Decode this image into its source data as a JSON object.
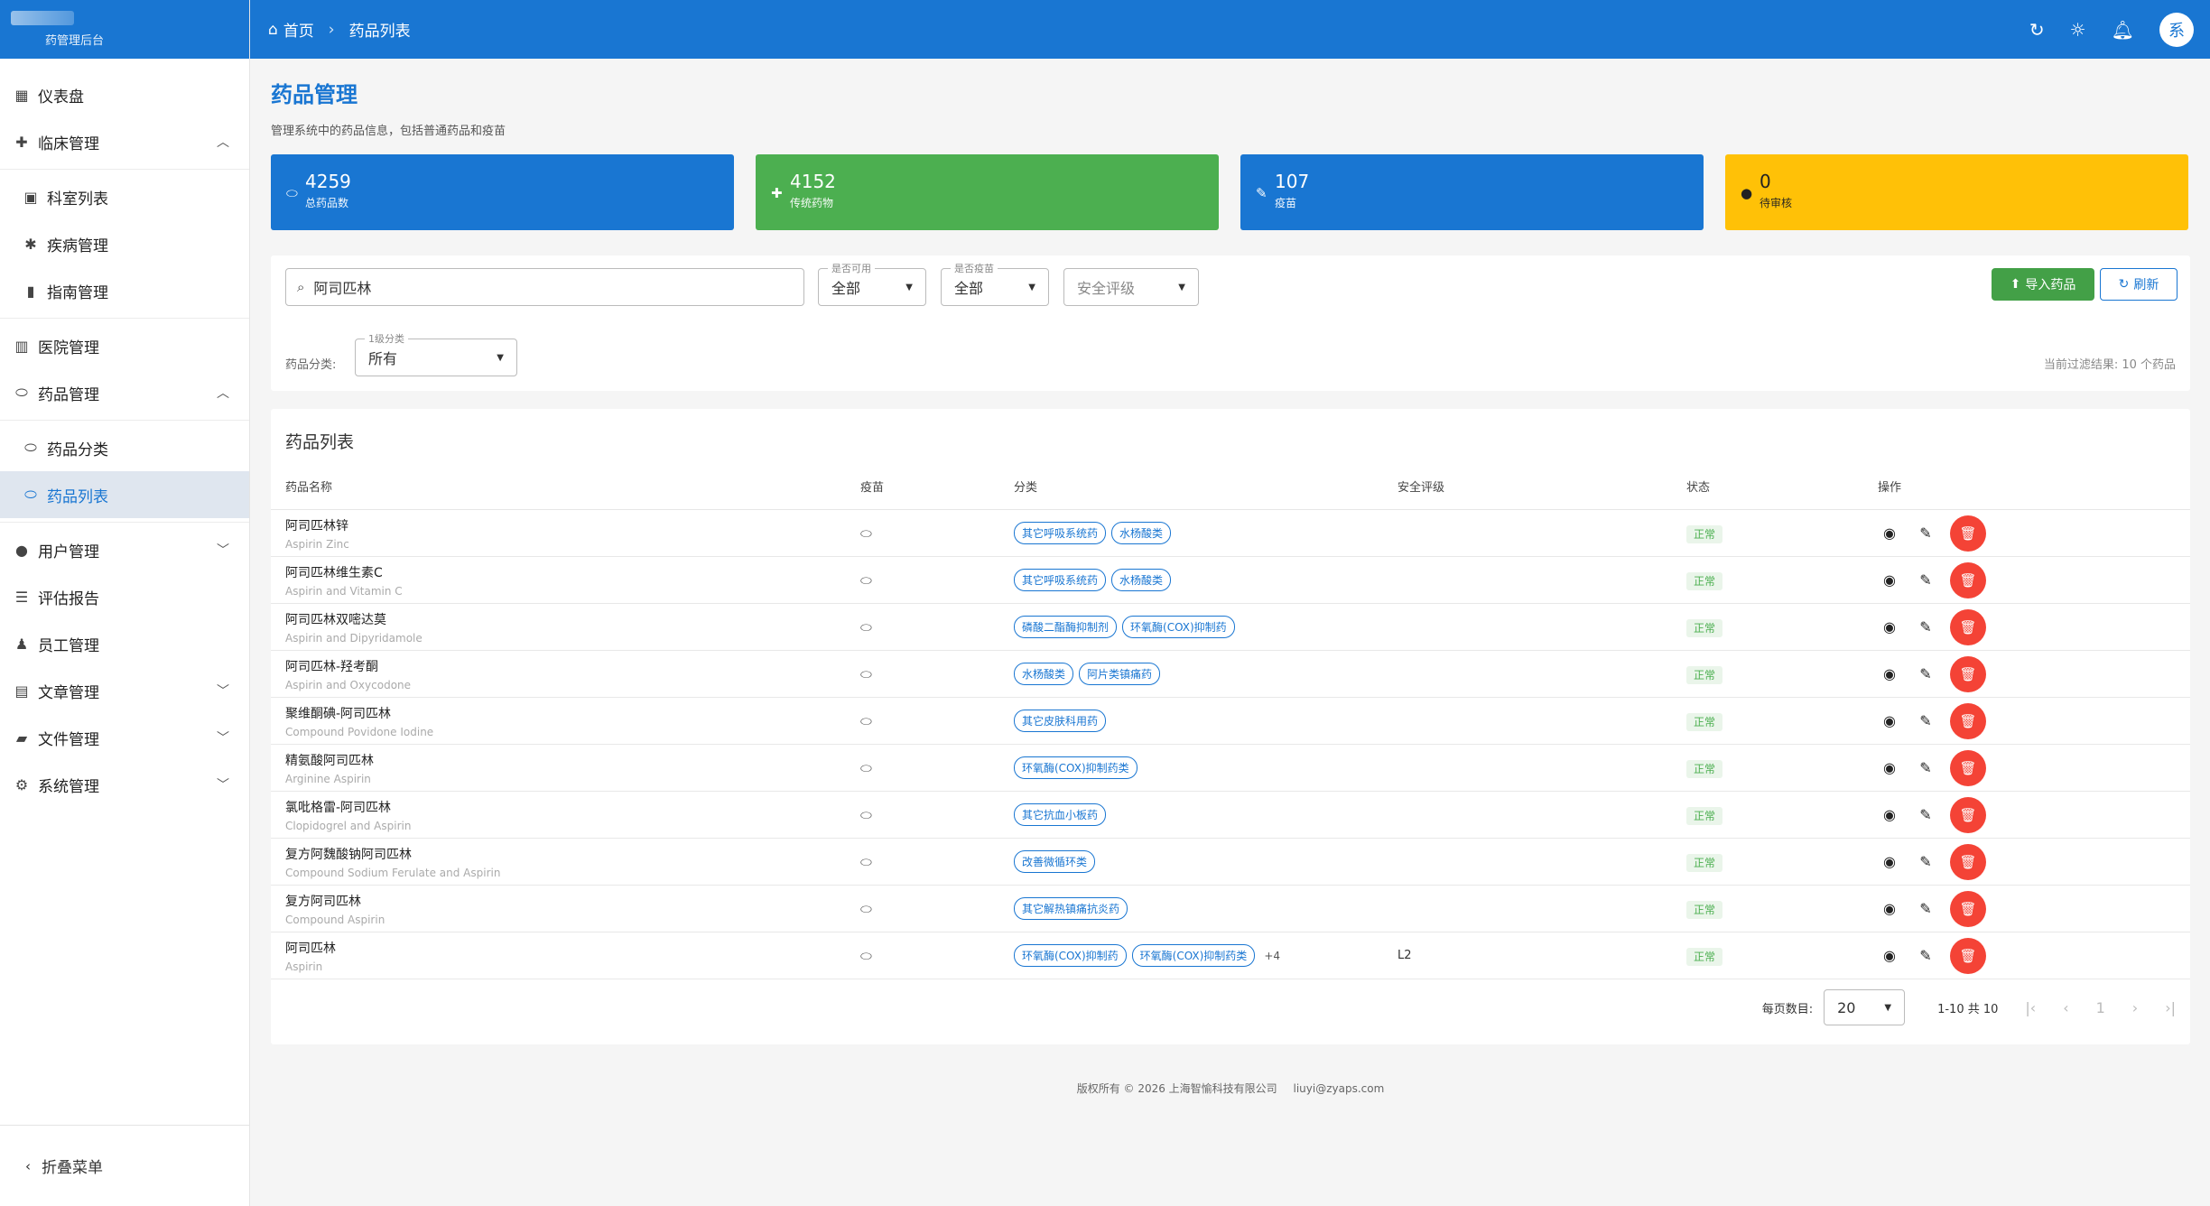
{
  "brand": {
    "name": "药管理后台"
  },
  "sidebar": {
    "items": [
      {
        "label": "仪表盘",
        "icon": "dashboard-icon"
      },
      {
        "label": "临床管理",
        "icon": "medical-bag-icon",
        "expanded": true
      },
      {
        "label": "科室列表",
        "icon": "door-icon"
      },
      {
        "label": "疾病管理",
        "icon": "virus-icon"
      },
      {
        "label": "指南管理",
        "icon": "book-icon"
      },
      {
        "label": "医院管理",
        "icon": "hospital-icon"
      },
      {
        "label": "药品管理",
        "icon": "pill-icon",
        "expanded": true
      },
      {
        "label": "药品分类",
        "icon": "pills-icon"
      },
      {
        "label": "药品列表",
        "icon": "pill-icon"
      },
      {
        "label": "用户管理",
        "icon": "user-icon",
        "expanded": false
      },
      {
        "label": "评估报告",
        "icon": "report-icon"
      },
      {
        "label": "员工管理",
        "icon": "staff-icon"
      },
      {
        "label": "文章管理",
        "icon": "article-icon",
        "expanded": false
      },
      {
        "label": "文件管理",
        "icon": "folder-icon",
        "expanded": false
      },
      {
        "label": "系统管理",
        "icon": "gear-icon",
        "expanded": false
      }
    ],
    "collapse_label": "折叠菜单"
  },
  "topbar": {
    "breadcrumb_home": "首页",
    "breadcrumb_current": "药品列表",
    "avatar_text": "系"
  },
  "page": {
    "title": "药品管理",
    "subtitle": "管理系统中的药品信息，包括普通药品和疫苗"
  },
  "stats": [
    {
      "value": "4259",
      "label": "总药品数",
      "color": "#1976d2"
    },
    {
      "value": "4152",
      "label": "传统药物",
      "color": "#4caf50"
    },
    {
      "value": "107",
      "label": "疫苗",
      "color": "#1976d2"
    },
    {
      "value": "0",
      "label": "待审核",
      "color": "#ffc107"
    }
  ],
  "filters": {
    "search_value": "阿司匹林",
    "available_label": "是否可用",
    "available_value": "全部",
    "vaccine_label": "是否疫苗",
    "vaccine_value": "全部",
    "safety_placeholder": "安全评级",
    "category_prefix": "药品分类:",
    "level1_label": "1级分类",
    "level1_value": "所有",
    "import_button": "导入药品",
    "refresh_button": "刷新",
    "result_text": "当前过滤结果: 10 个药品"
  },
  "table": {
    "title": "药品列表",
    "headers": {
      "name": "药品名称",
      "vaccine": "疫苗",
      "category": "分类",
      "safety": "安全评级",
      "status": "状态",
      "actions": "操作"
    },
    "rows": [
      {
        "name": "阿司匹林锌",
        "en": "Aspirin Zinc",
        "tags": [
          "其它呼吸系统药",
          "水杨酸类"
        ],
        "more": "",
        "safety": "",
        "status": "正常"
      },
      {
        "name": "阿司匹林维生素C",
        "en": "Aspirin and Vitamin C",
        "tags": [
          "其它呼吸系统药",
          "水杨酸类"
        ],
        "more": "",
        "safety": "",
        "status": "正常"
      },
      {
        "name": "阿司匹林双嘧达莫",
        "en": "Aspirin and Dipyridamole",
        "tags": [
          "磷酸二酯酶抑制剂",
          "环氧酶(COX)抑制药"
        ],
        "more": "",
        "safety": "",
        "status": "正常"
      },
      {
        "name": "阿司匹林-羟考酮",
        "en": "Aspirin and Oxycodone",
        "tags": [
          "水杨酸类",
          "阿片类镇痛药"
        ],
        "more": "",
        "safety": "",
        "status": "正常"
      },
      {
        "name": "聚维酮碘-阿司匹林",
        "en": "Compound Povidone Iodine",
        "tags": [
          "其它皮肤科用药"
        ],
        "more": "",
        "safety": "",
        "status": "正常"
      },
      {
        "name": "精氨酸阿司匹林",
        "en": "Arginine Aspirin",
        "tags": [
          "环氧酶(COX)抑制药类"
        ],
        "more": "",
        "safety": "",
        "status": "正常"
      },
      {
        "name": "氯吡格雷-阿司匹林",
        "en": "Clopidogrel and Aspirin",
        "tags": [
          "其它抗血小板药"
        ],
        "more": "",
        "safety": "",
        "status": "正常"
      },
      {
        "name": "复方阿魏酸钠阿司匹林",
        "en": "Compound Sodium Ferulate and Aspirin",
        "tags": [
          "改善微循环类"
        ],
        "more": "",
        "safety": "",
        "status": "正常"
      },
      {
        "name": "复方阿司匹林",
        "en": "Compound Aspirin",
        "tags": [
          "其它解热镇痛抗炎药"
        ],
        "more": "",
        "safety": "",
        "status": "正常"
      },
      {
        "name": "阿司匹林",
        "en": "Aspirin",
        "tags": [
          "环氧酶(COX)抑制药",
          "环氧酶(COX)抑制药类"
        ],
        "more": "+4",
        "safety": "L2",
        "status": "正常"
      }
    ]
  },
  "pagination": {
    "per_page_label": "每页数目:",
    "per_page_value": "20",
    "range_text": "1-10 共 10",
    "current_page": "1"
  },
  "footer": {
    "copyright": "版权所有 © 2026 上海智愉科技有限公司",
    "email": "liuyi@zyaps.com"
  }
}
